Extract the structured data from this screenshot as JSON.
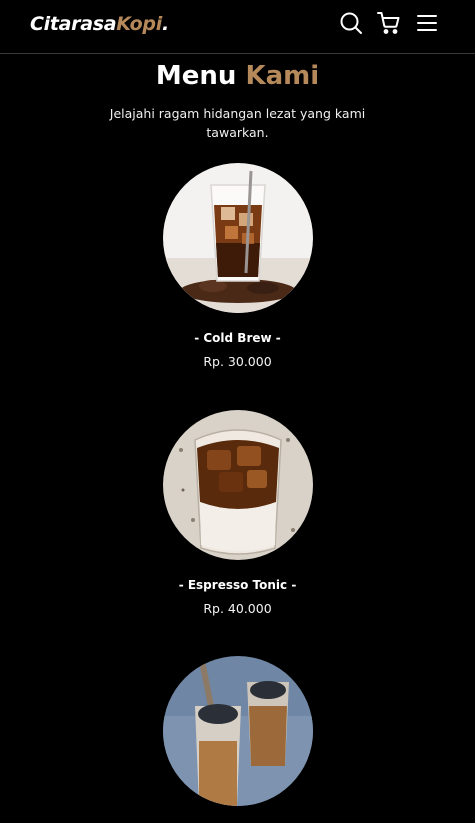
{
  "brand": {
    "name_main": "Citarasa",
    "name_accent": "Kopi",
    "name_dot": "."
  },
  "colors": {
    "accent": "#b6895b",
    "background": "#000000",
    "text": "#ffffff"
  },
  "nav": {
    "icons": [
      "search-icon",
      "shopping-cart-icon",
      "hamburger-menu-icon"
    ]
  },
  "menu": {
    "title_main": "Menu",
    "title_accent": "Kami",
    "description": "Jelajahi ragam hidangan lezat yang kami tawarkan.",
    "items": [
      {
        "name": "- Cold Brew -",
        "price": "Rp. 30.000"
      },
      {
        "name": "- Espresso Tonic -",
        "price": "Rp. 40.000"
      },
      {
        "name": "",
        "price": ""
      }
    ]
  }
}
